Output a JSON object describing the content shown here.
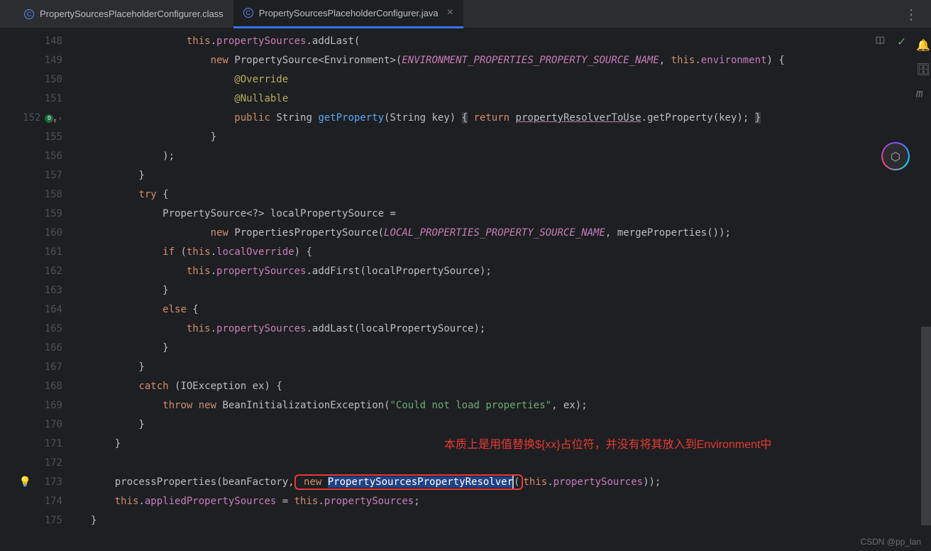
{
  "tabs": [
    {
      "label": "PropertySourcesPlaceholderConfigurer.class",
      "active": false
    },
    {
      "label": "PropertySourcesPlaceholderConfigurer.java",
      "active": true
    }
  ],
  "lines": [
    {
      "n": "148",
      "tokens": [
        [
          "pun",
          "                "
        ],
        [
          "this",
          "this"
        ],
        [
          "pun",
          "."
        ],
        [
          "field",
          "propertySources"
        ],
        [
          "pun",
          "."
        ],
        [
          "method",
          "addLast"
        ],
        [
          "pun",
          "("
        ]
      ]
    },
    {
      "n": "149",
      "tokens": [
        [
          "pun",
          "                    "
        ],
        [
          "kw",
          "new"
        ],
        [
          "pun",
          " "
        ],
        [
          "type",
          "PropertySource"
        ],
        [
          "pun",
          "<"
        ],
        [
          "type",
          "Environment"
        ],
        [
          "pun",
          ">("
        ],
        [
          "ital",
          "ENVIRONMENT_PROPERTIES_PROPERTY_SOURCE_NAME"
        ],
        [
          "pun",
          ", "
        ],
        [
          "this",
          "this"
        ],
        [
          "pun",
          "."
        ],
        [
          "field",
          "environment"
        ],
        [
          "pun",
          ") {"
        ]
      ]
    },
    {
      "n": "150",
      "tokens": [
        [
          "pun",
          "                        "
        ],
        [
          "ann",
          "@Override"
        ]
      ]
    },
    {
      "n": "151",
      "tokens": [
        [
          "pun",
          "                        "
        ],
        [
          "ann",
          "@Nullable"
        ]
      ]
    },
    {
      "n": "152",
      "override": true,
      "expander": true,
      "tokens": [
        [
          "pun",
          "                        "
        ],
        [
          "kw",
          "public"
        ],
        [
          "pun",
          " "
        ],
        [
          "type",
          "String"
        ],
        [
          "pun",
          " "
        ],
        [
          "fn",
          "getProperty"
        ],
        [
          "pun",
          "("
        ],
        [
          "type",
          "String"
        ],
        [
          "pun",
          " key) "
        ],
        [
          "brace-hi",
          "{"
        ],
        [
          "pun",
          " "
        ],
        [
          "kw",
          "return"
        ],
        [
          "pun",
          " "
        ],
        [
          "underline",
          "propertyResolverToUse"
        ],
        [
          "pun",
          "."
        ],
        [
          "method",
          "getProperty"
        ],
        [
          "pun",
          "(key); "
        ],
        [
          "brace-hi",
          "}"
        ]
      ]
    },
    {
      "n": "155",
      "tokens": [
        [
          "pun",
          "                    }"
        ]
      ]
    },
    {
      "n": "156",
      "tokens": [
        [
          "pun",
          "            );"
        ]
      ]
    },
    {
      "n": "157",
      "tokens": [
        [
          "pun",
          "        }"
        ]
      ]
    },
    {
      "n": "158",
      "tokens": [
        [
          "pun",
          "        "
        ],
        [
          "kw",
          "try"
        ],
        [
          "pun",
          " {"
        ]
      ]
    },
    {
      "n": "159",
      "tokens": [
        [
          "pun",
          "            "
        ],
        [
          "type",
          "PropertySource"
        ],
        [
          "pun",
          "<?> localPropertySource ="
        ]
      ]
    },
    {
      "n": "160",
      "tokens": [
        [
          "pun",
          "                    "
        ],
        [
          "kw",
          "new"
        ],
        [
          "pun",
          " "
        ],
        [
          "type",
          "PropertiesPropertySource"
        ],
        [
          "pun",
          "("
        ],
        [
          "ital",
          "LOCAL_PROPERTIES_PROPERTY_SOURCE_NAME"
        ],
        [
          "pun",
          ", mergeProperties());"
        ]
      ]
    },
    {
      "n": "161",
      "tokens": [
        [
          "pun",
          "            "
        ],
        [
          "kw",
          "if"
        ],
        [
          "pun",
          " ("
        ],
        [
          "this",
          "this"
        ],
        [
          "pun",
          "."
        ],
        [
          "field",
          "localOverride"
        ],
        [
          "pun",
          ") {"
        ]
      ]
    },
    {
      "n": "162",
      "tokens": [
        [
          "pun",
          "                "
        ],
        [
          "this",
          "this"
        ],
        [
          "pun",
          "."
        ],
        [
          "field",
          "propertySources"
        ],
        [
          "pun",
          "."
        ],
        [
          "method",
          "addFirst"
        ],
        [
          "pun",
          "(localPropertySource);"
        ]
      ]
    },
    {
      "n": "163",
      "tokens": [
        [
          "pun",
          "            }"
        ]
      ]
    },
    {
      "n": "164",
      "tokens": [
        [
          "pun",
          "            "
        ],
        [
          "kw",
          "else"
        ],
        [
          "pun",
          " {"
        ]
      ]
    },
    {
      "n": "165",
      "tokens": [
        [
          "pun",
          "                "
        ],
        [
          "this",
          "this"
        ],
        [
          "pun",
          "."
        ],
        [
          "field",
          "propertySources"
        ],
        [
          "pun",
          "."
        ],
        [
          "method",
          "addLast"
        ],
        [
          "pun",
          "(localPropertySource);"
        ]
      ]
    },
    {
      "n": "166",
      "tokens": [
        [
          "pun",
          "            }"
        ]
      ]
    },
    {
      "n": "167",
      "tokens": [
        [
          "pun",
          "        }"
        ]
      ]
    },
    {
      "n": "168",
      "tokens": [
        [
          "pun",
          "        "
        ],
        [
          "kw",
          "catch"
        ],
        [
          "pun",
          " ("
        ],
        [
          "type",
          "IOException"
        ],
        [
          "pun",
          " ex) {"
        ]
      ]
    },
    {
      "n": "169",
      "tokens": [
        [
          "pun",
          "            "
        ],
        [
          "kw",
          "throw"
        ],
        [
          "pun",
          " "
        ],
        [
          "kw",
          "new"
        ],
        [
          "pun",
          " "
        ],
        [
          "type",
          "BeanInitializationException"
        ],
        [
          "pun",
          "("
        ],
        [
          "str",
          "\"Could not load properties\""
        ],
        [
          "pun",
          ", ex);"
        ]
      ]
    },
    {
      "n": "170",
      "tokens": [
        [
          "pun",
          "        }"
        ]
      ]
    },
    {
      "n": "171",
      "tokens": [
        [
          "pun",
          "    }"
        ]
      ]
    },
    {
      "n": "172",
      "tokens": []
    },
    {
      "n": "173",
      "bulb": true,
      "highlighted": true
    },
    {
      "n": "174",
      "tokens": [
        [
          "pun",
          "    "
        ],
        [
          "this",
          "this"
        ],
        [
          "pun",
          "."
        ],
        [
          "field",
          "appliedPropertySources"
        ],
        [
          "pun",
          " = "
        ],
        [
          "this",
          "this"
        ],
        [
          "pun",
          "."
        ],
        [
          "field",
          "propertySources"
        ],
        [
          "pun",
          ";"
        ]
      ]
    },
    {
      "n": "175",
      "tokens": [
        [
          "pun",
          "}"
        ]
      ]
    }
  ],
  "line173": {
    "prefix": "    processProperties(beanFactory,",
    "new_kw": " new ",
    "selected": "PropertySourcesPropertyResolver",
    "after_sel_open": "(",
    "this_kw": "this",
    "dot": ".",
    "field": "propertySources",
    "close": "));"
  },
  "annotation": "本质上是用值替换${xx}占位符，并没有将其放入到Environment中",
  "watermark": "CSDN @pp_lan"
}
